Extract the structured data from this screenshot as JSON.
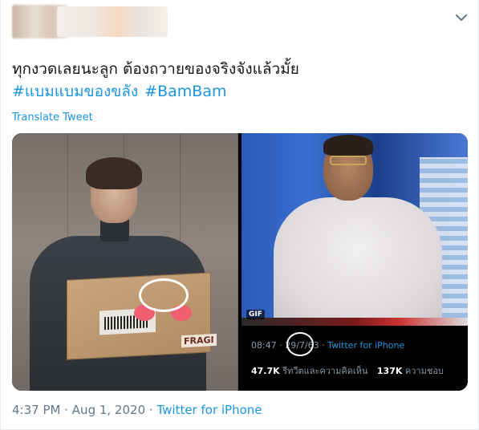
{
  "tweet": {
    "text_line1": "ทุกงวดเลยนะลูก ต้องถวายของจริงจังแล้วมั้ย",
    "hashtags": [
      "#แบมแบมของขลัง",
      "#BamBam"
    ],
    "translate_label": "Translate Tweet",
    "time": "4:37 PM",
    "separator": "·",
    "date": "Aug 1, 2020",
    "source": "Twitter for iPhone"
  },
  "left_photo": {
    "box_text": "FRAGI"
  },
  "right_photo": {
    "gif_badge": "GIF",
    "embedded_meta": {
      "time": "08:47",
      "date": "29/7/63",
      "separator": "·",
      "source": "Twitter for iPhone"
    },
    "embedded_stats": {
      "retweets_value": "47.7K",
      "retweets_label": "รีทวีตและความคิดเห็น",
      "likes_value": "137K",
      "likes_label": "ความชอบ"
    }
  },
  "icons": {
    "menu": "chevron-down-icon"
  },
  "colors": {
    "link": "#1b95e0",
    "text": "#14171a",
    "muted": "#657786",
    "annotation_heart": "#f25f73"
  }
}
